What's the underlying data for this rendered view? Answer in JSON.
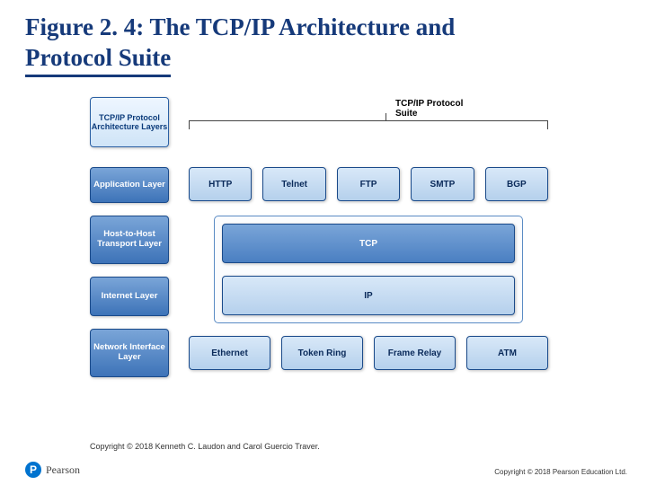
{
  "title_a": "Figure 2. 4: The TCP/IP Architecture and",
  "title_b": "Protocol Suite",
  "layers_header": "TCP/IP Protocol Architecture Layers",
  "layers": [
    "Application Layer",
    "Host-to-Host Transport Layer",
    "Internet Layer",
    "Network Interface Layer"
  ],
  "suite_label": "TCP/IP Protocol Suite",
  "row_app": [
    "HTTP",
    "Telnet",
    "FTP",
    "SMTP",
    "BGP"
  ],
  "row_trans": [
    "TCP"
  ],
  "row_inet": [
    "IP"
  ],
  "row_net": [
    "Ethernet",
    "Token Ring",
    "Frame Relay",
    "ATM"
  ],
  "image_copyright": "Copyright © 2018 Kenneth C. Laudon and Carol Guercio Traver.",
  "footer_copyright": "Copyright © 2018 Pearson Education Ltd.",
  "brand": "Pearson",
  "brand_letter": "P"
}
